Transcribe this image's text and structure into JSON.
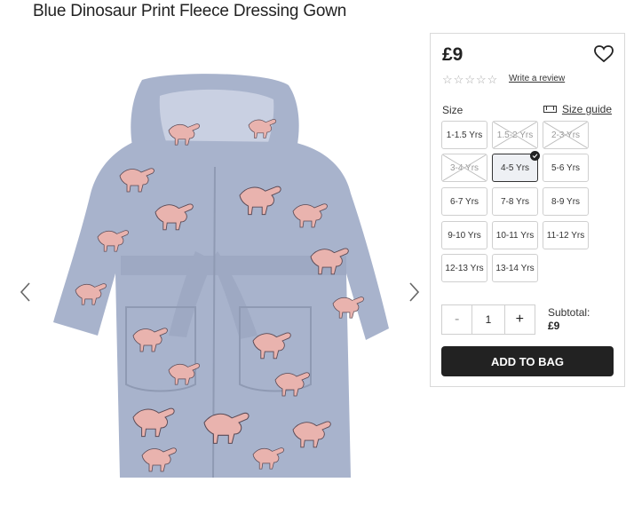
{
  "product": {
    "title": "Blue Dinosaur Print Fleece Dressing Gown",
    "image_alt": "Blue dressing gown with pink dinosaur print"
  },
  "gallery": {
    "prev_icon": "chevron-left-icon",
    "next_icon": "chevron-right-icon"
  },
  "panel": {
    "price": "£9",
    "wishlist_icon": "heart-icon",
    "rating_stars": 0,
    "review_link": "Write a review",
    "size_label": "Size",
    "size_guide_link": "Size guide",
    "sizes": [
      {
        "label": "1-1.5 Yrs",
        "available": true
      },
      {
        "label": "1.5-2 Yrs",
        "available": false
      },
      {
        "label": "2-3 Yrs",
        "available": false
      },
      {
        "label": "3-4 Yrs",
        "available": false
      },
      {
        "label": "4-5 Yrs",
        "available": true,
        "selected": true
      },
      {
        "label": "5-6 Yrs",
        "available": true
      },
      {
        "label": "6-7 Yrs",
        "available": true
      },
      {
        "label": "7-8 Yrs",
        "available": true
      },
      {
        "label": "8-9 Yrs",
        "available": true
      },
      {
        "label": "9-10 Yrs",
        "available": true
      },
      {
        "label": "10-11 Yrs",
        "available": true
      },
      {
        "label": "11-12 Yrs",
        "available": true
      },
      {
        "label": "12-13 Yrs",
        "available": true
      },
      {
        "label": "13-14 Yrs",
        "available": true
      }
    ],
    "quantity": {
      "minus": "-",
      "value": "1",
      "plus": "+"
    },
    "subtotal_label": "Subtotal:",
    "subtotal_value": "£9",
    "add_to_bag": "ADD TO BAG"
  },
  "colors": {
    "gown": "#a8b3cc",
    "dino": "#e9b3ae",
    "button": "#222222"
  }
}
